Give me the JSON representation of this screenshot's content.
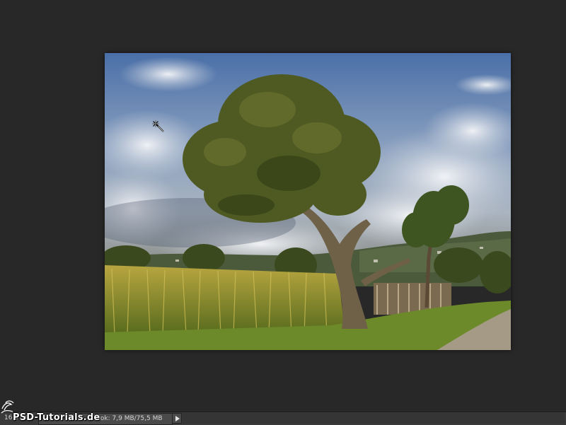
{
  "status_bar": {
    "zoom": "16,67%",
    "doc_info": "Dok: 7,9 MB/75,5 MB",
    "menu_arrow_icon": "triangle-right-icon"
  },
  "watermark": {
    "text": "PSD-Tutorials.de",
    "logo_icon": "psd-tutorials-logo-icon"
  },
  "cursor": {
    "icon": "magic-wand-cursor-icon"
  },
  "photo": {
    "description_icon": "landscape-photo",
    "colors": {
      "sky_top": "#4a6fa8",
      "cloud": "#e8ecf2",
      "tree_canopy": "#4e5a22",
      "corn": "#9a9a2a",
      "grass": "#6c8a2a"
    }
  }
}
